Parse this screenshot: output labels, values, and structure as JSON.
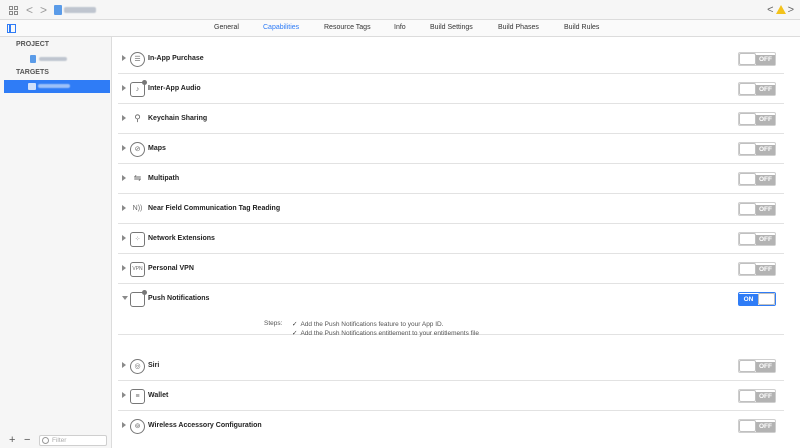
{
  "toolbar": {
    "nav_back": "<",
    "nav_forward": ">",
    "right_back": "<",
    "right_forward": ">",
    "colors": {
      "accent": "#2f7cf6",
      "warning": "#f3c21b"
    }
  },
  "tabs": [
    {
      "label": "General"
    },
    {
      "label": "Capabilities"
    },
    {
      "label": "Resource Tags"
    },
    {
      "label": "Info"
    },
    {
      "label": "Build Settings"
    },
    {
      "label": "Build Phases"
    },
    {
      "label": "Build Rules"
    }
  ],
  "sidebar": {
    "project_title": "PROJECT",
    "targets_title": "TARGETS",
    "add_label": "+",
    "remove_label": "−",
    "filter_placeholder": "Filter"
  },
  "capabilities": [
    {
      "label": "In-App Purchase",
      "icon": "in-app-purchase-icon",
      "state": "OFF"
    },
    {
      "label": "Inter-App Audio",
      "icon": "inter-app-audio-icon",
      "state": "OFF"
    },
    {
      "label": "Keychain Sharing",
      "icon": "keychain-icon",
      "state": "OFF"
    },
    {
      "label": "Maps",
      "icon": "maps-icon",
      "state": "OFF"
    },
    {
      "label": "Multipath",
      "icon": "multipath-icon",
      "state": "OFF"
    },
    {
      "label": "Near Field Communication Tag Reading",
      "icon": "nfc-icon",
      "state": "OFF"
    },
    {
      "label": "Network Extensions",
      "icon": "network-extensions-icon",
      "state": "OFF"
    },
    {
      "label": "Personal VPN",
      "icon": "vpn-icon",
      "state": "OFF"
    },
    {
      "label": "Push Notifications",
      "icon": "push-notifications-icon",
      "state": "ON"
    },
    {
      "label": "Siri",
      "icon": "siri-icon",
      "state": "OFF"
    },
    {
      "label": "Wallet",
      "icon": "wallet-icon",
      "state": "OFF"
    },
    {
      "label": "Wireless Accessory Configuration",
      "icon": "wireless-accessory-icon",
      "state": "OFF"
    }
  ],
  "push": {
    "steps_label": "Steps:",
    "steps": [
      "Add the Push Notifications feature to your App ID.",
      "Add the Push Notifications entitlement to your entitlements file"
    ]
  },
  "icon_glyphs": {
    "vpn": "VPN",
    "nfc": "N))",
    "multipath": "⇋",
    "keychain": "⚲",
    "maps": "⊘",
    "siri": "◎",
    "wireless": "⊚",
    "network": "⁘"
  }
}
